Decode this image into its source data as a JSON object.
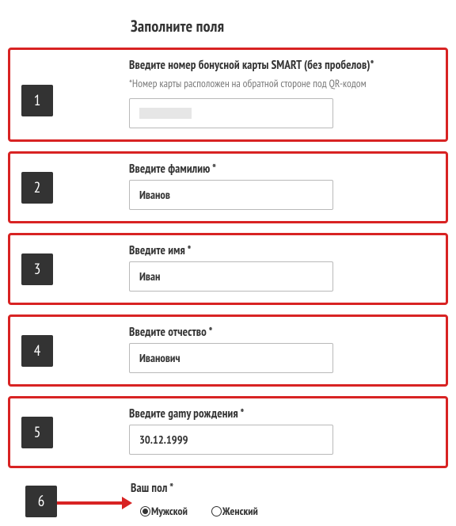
{
  "title": "Заполните поля",
  "markers": {
    "m1": "1",
    "m2": "2",
    "m3": "3",
    "m4": "4",
    "m5": "5",
    "m6": "6"
  },
  "card": {
    "label": "Введите номер бонусной карты SMART (без пробелов)*",
    "hint": "*Номер карты расположен на обратной стороне под QR-кодом",
    "value": ""
  },
  "surname": {
    "label": "Введите фамилию *",
    "value": "Иванов"
  },
  "firstname": {
    "label": "Введите имя *",
    "value": "Иван"
  },
  "patronymic": {
    "label": "Введите отчество *",
    "value": "Иванович"
  },
  "birthdate": {
    "label": "Введите gamy рождения *",
    "value": "30.12.1999"
  },
  "gender": {
    "label": "Ваш пол *",
    "male": "Мужской",
    "female": "Женский",
    "selected": "male"
  }
}
